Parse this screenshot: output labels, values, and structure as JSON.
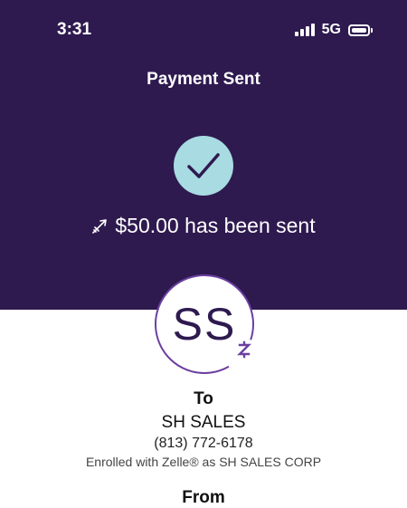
{
  "status_bar": {
    "time": "3:31",
    "network": "5G"
  },
  "header": {
    "title": "Payment Sent"
  },
  "confirmation": {
    "message": "$50.00 has been sent"
  },
  "recipient": {
    "initials": "SS",
    "to_label": "To",
    "name": "SH SALES",
    "phone": "(813) 772-6178",
    "enrolled_text": "Enrolled with Zelle® as SH SALES CORP"
  },
  "sender": {
    "from_label": "From"
  },
  "colors": {
    "header_bg": "#2e1a4f",
    "check_bg": "#a8dbe2",
    "accent": "#6b3fa0"
  },
  "icons": [
    "signal-icon",
    "battery-icon",
    "checkmark-icon",
    "send-icon",
    "zelle-icon"
  ]
}
